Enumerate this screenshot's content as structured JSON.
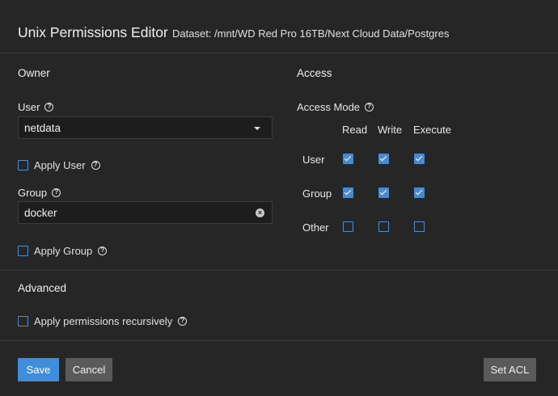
{
  "dialog": {
    "title": "Unix Permissions Editor",
    "subtitle": "Dataset:  /mnt/WD Red Pro 16TB/Next Cloud Data/Postgres"
  },
  "owner": {
    "section_title": "Owner",
    "user_label": "User",
    "user_value": "netdata",
    "apply_user_label": "Apply User",
    "apply_user_checked": false,
    "group_label": "Group",
    "group_value": "docker",
    "apply_group_label": "Apply Group",
    "apply_group_checked": false
  },
  "access": {
    "section_title": "Access",
    "mode_label": "Access Mode",
    "columns": [
      "Read",
      "Write",
      "Execute"
    ],
    "rows": [
      {
        "label": "User",
        "values": [
          true,
          true,
          true
        ]
      },
      {
        "label": "Group",
        "values": [
          true,
          true,
          true
        ]
      },
      {
        "label": "Other",
        "values": [
          false,
          false,
          false
        ]
      }
    ]
  },
  "advanced": {
    "section_title": "Advanced",
    "recursive_label": "Apply permissions recursively",
    "recursive_checked": false
  },
  "buttons": {
    "save": "Save",
    "cancel": "Cancel",
    "set_acl": "Set ACL"
  },
  "colors": {
    "primary": "#3f8ddb",
    "checkbox": "#4a8acc",
    "background": "#262626"
  }
}
